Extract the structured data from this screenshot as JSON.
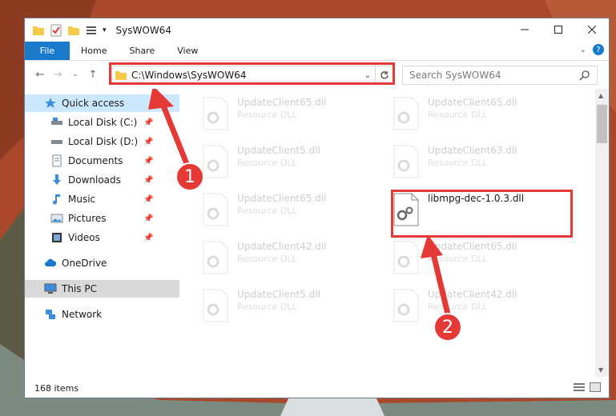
{
  "window": {
    "title": "SysWOW64"
  },
  "ribbon": {
    "tabs": [
      "File",
      "Home",
      "Share",
      "View"
    ]
  },
  "address": {
    "path": "C:\\Windows\\SysWOW64",
    "search_placeholder": "Search SysWOW64"
  },
  "sidebar": {
    "quick_access": "Quick access",
    "items": [
      {
        "label": "Local Disk (C:)",
        "icon": "drive-icon"
      },
      {
        "label": "Local Disk (D:)",
        "icon": "drive-icon"
      },
      {
        "label": "Documents",
        "icon": "documents-icon"
      },
      {
        "label": "Downloads",
        "icon": "downloads-icon"
      },
      {
        "label": "Music",
        "icon": "music-icon"
      },
      {
        "label": "Pictures",
        "icon": "pictures-icon"
      },
      {
        "label": "Videos",
        "icon": "videos-icon"
      }
    ],
    "onedrive": "OneDrive",
    "this_pc": "This PC",
    "network": "Network"
  },
  "files": [
    {
      "name": "UpdateClient65.dll",
      "type": "Resource DLL"
    },
    {
      "name": "UpdateClient65.dll",
      "type": "Resource DLL"
    },
    {
      "name": "UpdateClient5.dll",
      "type": "Resource DLL"
    },
    {
      "name": "UpdateClient63.dll",
      "type": "Resource DLL"
    },
    {
      "name": "UpdateClient65.dll",
      "type": "Resource DLL"
    },
    {
      "name": "libmpg-dec-1.0.3.dll",
      "type": ""
    },
    {
      "name": "UpdateClient42.dll",
      "type": "Resource DLL"
    },
    {
      "name": "UpdateClient65.dll",
      "type": "Resource DLL"
    },
    {
      "name": "UpdateClient5.dll",
      "type": "Resource DLL"
    },
    {
      "name": "UpdateClient42.dll",
      "type": "Resource DLL"
    }
  ],
  "status": {
    "items_count": "168 items"
  },
  "callouts": [
    "1",
    "2"
  ],
  "colors": {
    "accent": "#1979ca",
    "highlight": "#e53935"
  }
}
